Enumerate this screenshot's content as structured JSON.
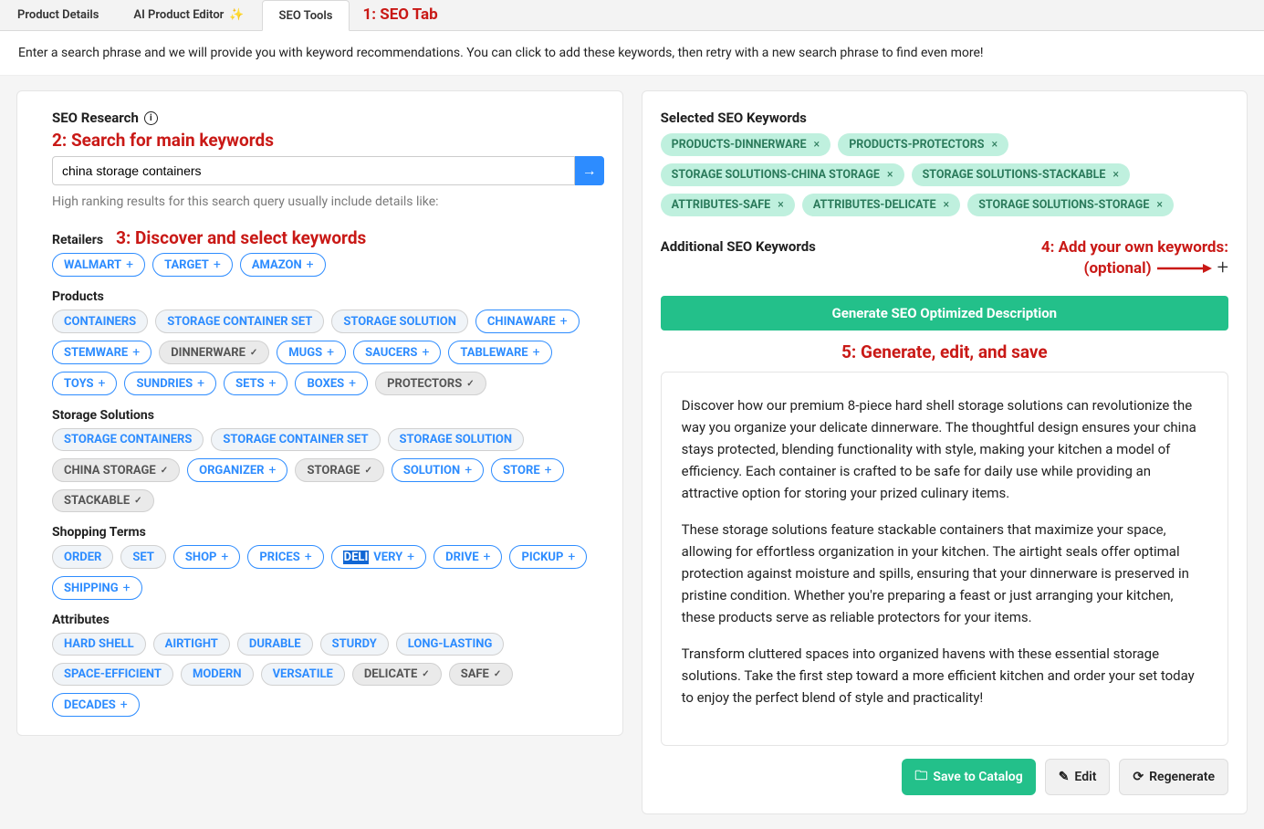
{
  "tabs": {
    "product_details": "Product Details",
    "ai_editor": "AI Product Editor",
    "seo_tools": "SEO Tools"
  },
  "annotations": {
    "a1": "1: SEO Tab",
    "a2": "2: Search for main keywords",
    "a3": "3: Discover and select keywords",
    "a4_line1": "4: Add your own keywords:",
    "a4_line2": "(optional)",
    "a5": "5: Generate, edit, and save"
  },
  "intro": "Enter a search phrase and we will provide you with keyword recommendations. You can click to add these keywords, then retry with a new search phrase to find even more!",
  "research": {
    "heading": "SEO Research",
    "search_value": "china storage containers",
    "hint": "High ranking results for this search query usually include details like:",
    "groups": [
      {
        "title": "Retailers",
        "items": [
          {
            "label": "WALMART",
            "icon": "+",
            "style": "blue"
          },
          {
            "label": "TARGET",
            "icon": "+",
            "style": "blue"
          },
          {
            "label": "AMAZON",
            "icon": "+",
            "style": "blue"
          }
        ]
      },
      {
        "title": "Products",
        "items": [
          {
            "label": "CONTAINERS",
            "icon": "",
            "style": "noicon"
          },
          {
            "label": "STORAGE CONTAINER SET",
            "icon": "",
            "style": "noicon"
          },
          {
            "label": "STORAGE SOLUTION",
            "icon": "",
            "style": "noicon"
          },
          {
            "label": "CHINAWARE",
            "icon": "+",
            "style": "blue"
          },
          {
            "label": "STEMWARE",
            "icon": "+",
            "style": "blue"
          },
          {
            "label": "DINNERWARE",
            "icon": "✓",
            "style": "grey"
          },
          {
            "label": "MUGS",
            "icon": "+",
            "style": "blue"
          },
          {
            "label": "SAUCERS",
            "icon": "+",
            "style": "blue"
          },
          {
            "label": "TABLEWARE",
            "icon": "+",
            "style": "blue"
          },
          {
            "label": "TOYS",
            "icon": "+",
            "style": "blue"
          },
          {
            "label": "SUNDRIES",
            "icon": "+",
            "style": "blue"
          },
          {
            "label": "SETS",
            "icon": "+",
            "style": "blue"
          },
          {
            "label": "BOXES",
            "icon": "+",
            "style": "blue"
          },
          {
            "label": "PROTECTORS",
            "icon": "✓",
            "style": "grey"
          }
        ]
      },
      {
        "title": "Storage Solutions",
        "items": [
          {
            "label": "STORAGE CONTAINERS",
            "icon": "",
            "style": "noicon"
          },
          {
            "label": "STORAGE CONTAINER SET",
            "icon": "",
            "style": "noicon"
          },
          {
            "label": "STORAGE SOLUTION",
            "icon": "",
            "style": "noicon"
          },
          {
            "label": "CHINA STORAGE",
            "icon": "✓",
            "style": "grey"
          },
          {
            "label": "ORGANIZER",
            "icon": "+",
            "style": "blue"
          },
          {
            "label": "STORAGE",
            "icon": "✓",
            "style": "grey"
          },
          {
            "label": "SOLUTION",
            "icon": "+",
            "style": "blue"
          },
          {
            "label": "STORE",
            "icon": "+",
            "style": "blue"
          },
          {
            "label": "STACKABLE",
            "icon": "✓",
            "style": "grey"
          }
        ]
      },
      {
        "title": "Shopping Terms",
        "items": [
          {
            "label": "ORDER",
            "icon": "",
            "style": "noicon"
          },
          {
            "label": "SET",
            "icon": "",
            "style": "noicon"
          },
          {
            "label": "SHOP",
            "icon": "+",
            "style": "blue"
          },
          {
            "label": "PRICES",
            "icon": "+",
            "style": "blue"
          },
          {
            "label": "DELIVERY",
            "icon": "+",
            "style": "blue",
            "highlight": "DELI"
          },
          {
            "label": "DRIVE",
            "icon": "+",
            "style": "blue"
          },
          {
            "label": "PICKUP",
            "icon": "+",
            "style": "blue"
          },
          {
            "label": "SHIPPING",
            "icon": "+",
            "style": "blue"
          }
        ]
      },
      {
        "title": "Attributes",
        "items": [
          {
            "label": "HARD SHELL",
            "icon": "",
            "style": "noicon"
          },
          {
            "label": "AIRTIGHT",
            "icon": "",
            "style": "noicon"
          },
          {
            "label": "DURABLE",
            "icon": "",
            "style": "noicon"
          },
          {
            "label": "STURDY",
            "icon": "",
            "style": "noicon"
          },
          {
            "label": "LONG-LASTING",
            "icon": "",
            "style": "noicon"
          },
          {
            "label": "SPACE-EFFICIENT",
            "icon": "",
            "style": "noicon"
          },
          {
            "label": "MODERN",
            "icon": "",
            "style": "noicon"
          },
          {
            "label": "VERSATILE",
            "icon": "",
            "style": "noicon"
          },
          {
            "label": "DELICATE",
            "icon": "✓",
            "style": "grey"
          },
          {
            "label": "SAFE",
            "icon": "✓",
            "style": "grey"
          },
          {
            "label": "DECADES",
            "icon": "+",
            "style": "blue"
          }
        ]
      }
    ]
  },
  "selected": {
    "heading": "Selected SEO Keywords",
    "items": [
      "PRODUCTS-DINNERWARE",
      "PRODUCTS-PROTECTORS",
      "STORAGE SOLUTIONS-CHINA STORAGE",
      "STORAGE SOLUTIONS-STACKABLE",
      "ATTRIBUTES-SAFE",
      "ATTRIBUTES-DELICATE",
      "STORAGE SOLUTIONS-STORAGE"
    ]
  },
  "additional": {
    "heading": "Additional SEO Keywords"
  },
  "generate": {
    "label": "Generate SEO Optimized Description"
  },
  "description": {
    "p1": "Discover how our premium 8-piece hard shell storage solutions can revolutionize the way you organize your delicate dinnerware. The thoughtful design ensures your china stays protected, blending functionality with style, making your kitchen a model of efficiency. Each container is crafted to be safe for daily use while providing an attractive option for storing your prized culinary items.",
    "p2": "These storage solutions feature stackable containers that maximize your space, allowing for effortless organization in your kitchen. The airtight seals offer optimal protection against moisture and spills, ensuring that your dinnerware is preserved in pristine condition. Whether you're preparing a feast or just arranging your kitchen, these products serve as reliable protectors for your items.",
    "p3": "Transform cluttered spaces into organized havens with these essential storage solutions. Take the first step toward a more efficient kitchen and order your set today to enjoy the perfect blend of style and practicality!"
  },
  "actions": {
    "save": "Save to Catalog",
    "edit": "Edit",
    "regenerate": "Regenerate"
  }
}
